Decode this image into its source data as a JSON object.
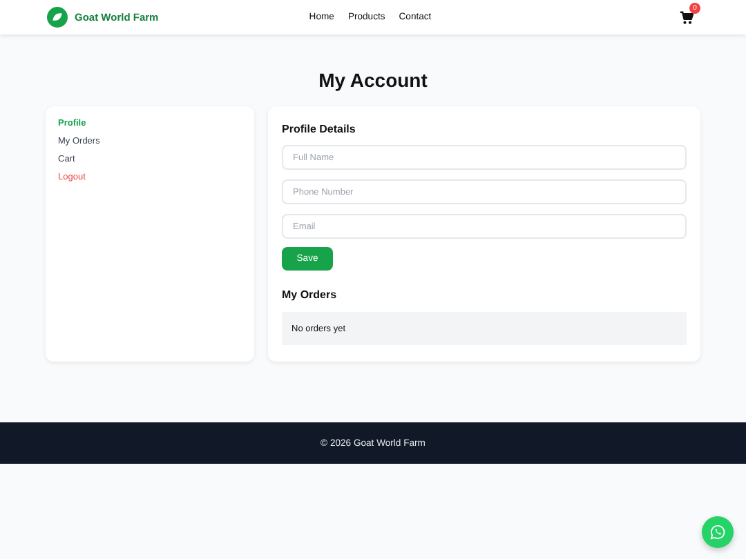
{
  "header": {
    "brand": "Goat World Farm",
    "nav": [
      "Home",
      "Products",
      "Contact"
    ],
    "cart_count": "0"
  },
  "title": "My Account",
  "sidebar": {
    "items": [
      {
        "label": "Profile",
        "kind": "link",
        "selected": true
      },
      {
        "label": "My Orders",
        "kind": "link",
        "selected": false
      },
      {
        "label": "Cart",
        "kind": "link",
        "selected": false
      },
      {
        "label": "Logout",
        "kind": "logout",
        "selected": false
      }
    ]
  },
  "profile": {
    "heading": "Profile Details",
    "fields": [
      {
        "placeholder": "Full Name"
      },
      {
        "placeholder": "Phone Number"
      },
      {
        "placeholder": "Email"
      }
    ],
    "save": "Save"
  },
  "orders": {
    "heading": "My Orders",
    "empty": "No orders yet"
  },
  "footer": "© 2026 Goat World Farm"
}
